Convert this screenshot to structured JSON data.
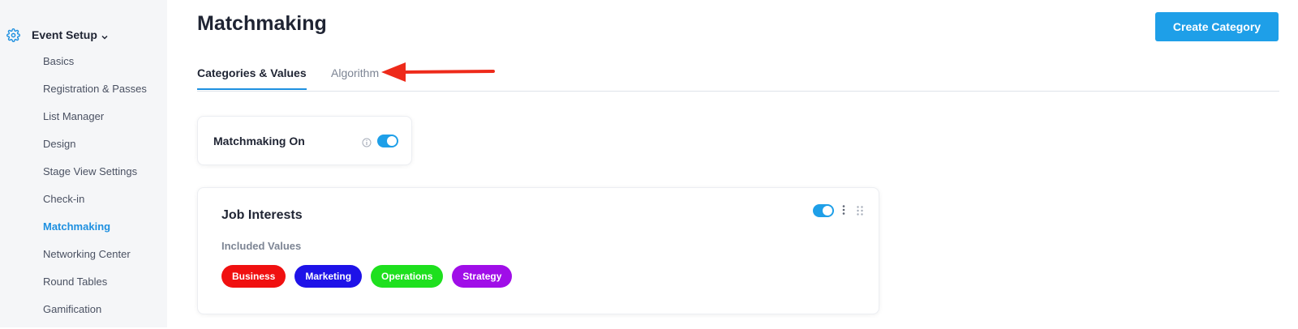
{
  "sidebar": {
    "section_title": "Event Setup",
    "section_icon": "gear-icon",
    "items": [
      {
        "label": "Basics",
        "active": false
      },
      {
        "label": "Registration & Passes",
        "active": false
      },
      {
        "label": "List Manager",
        "active": false
      },
      {
        "label": "Design",
        "active": false
      },
      {
        "label": "Stage View Settings",
        "active": false
      },
      {
        "label": "Check-in",
        "active": false
      },
      {
        "label": "Matchmaking",
        "active": true
      },
      {
        "label": "Networking Center",
        "active": false
      },
      {
        "label": "Round Tables",
        "active": false
      },
      {
        "label": "Gamification",
        "active": false
      }
    ]
  },
  "header": {
    "title": "Matchmaking",
    "create_button": "Create Category"
  },
  "tabs": [
    {
      "label": "Categories & Values",
      "active": true
    },
    {
      "label": "Algorithm",
      "active": false
    }
  ],
  "matchmaking_toggle": {
    "label": "Matchmaking On",
    "enabled": true
  },
  "category_card": {
    "title": "Job Interests",
    "subtitle": "Included Values",
    "enabled": true,
    "values": [
      {
        "label": "Business",
        "color": "#f01010"
      },
      {
        "label": "Marketing",
        "color": "#1e12e8"
      },
      {
        "label": "Operations",
        "color": "#1ee01e"
      },
      {
        "label": "Strategy",
        "color": "#a00ee8"
      }
    ]
  },
  "colors": {
    "accent": "#1e9fe8",
    "annotation_arrow": "#ee2a1a"
  }
}
